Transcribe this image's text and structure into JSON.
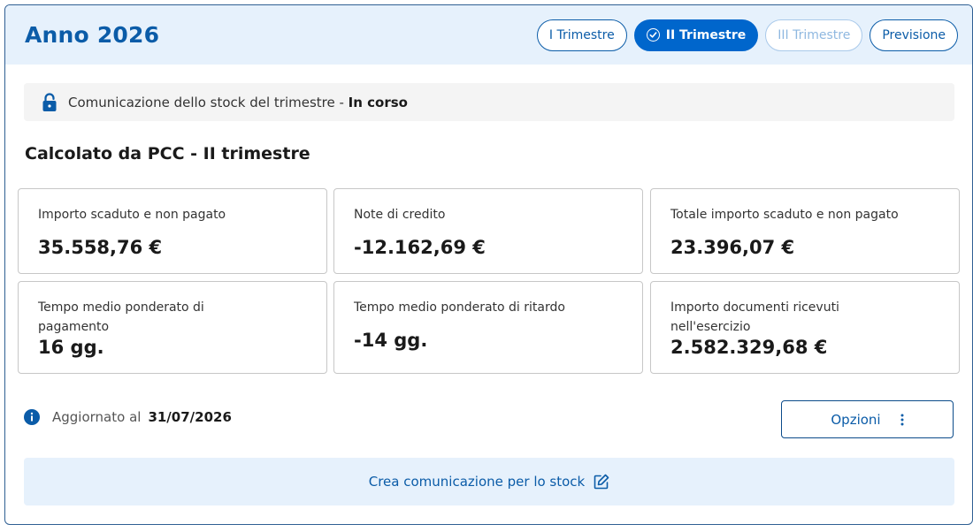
{
  "header": {
    "year_title": "Anno 2026",
    "tabs": [
      {
        "label": "I Trimestre",
        "state": "default"
      },
      {
        "label": "II Trimestre",
        "state": "active"
      },
      {
        "label": "III Trimestre",
        "state": "disabled"
      },
      {
        "label": "Previsione",
        "state": "default"
      }
    ]
  },
  "status": {
    "text": "Comunicazione dello stock del trimestre",
    "separator": " - ",
    "state": "In corso",
    "icon": "lock-icon"
  },
  "section": {
    "title": "Calcolato da PCC - II trimestre"
  },
  "metrics": [
    {
      "label": "Importo scaduto e non pagato",
      "value": "35.558,76 €"
    },
    {
      "label": "Note di credito",
      "value": "-12.162,69 €"
    },
    {
      "label": "Totale importo scaduto e non pagato",
      "value": "23.396,07 €"
    },
    {
      "label": "Tempo medio ponderato di pagamento",
      "value": "16 gg."
    },
    {
      "label": "Tempo medio ponderato di ritardo",
      "value": "-14 gg."
    },
    {
      "label": "Importo documenti ricevuti nell'esercizio",
      "value": "2.582.329,68 €"
    }
  ],
  "footer": {
    "updated_label": "Aggiornato al",
    "updated_date": "31/07/2026",
    "options_label": "Opzioni",
    "create_label": "Crea comunicazione per lo stock"
  },
  "colors": {
    "primary": "#0066cc",
    "header_bg": "#e6f1fc",
    "border": "#c7c7c7"
  }
}
